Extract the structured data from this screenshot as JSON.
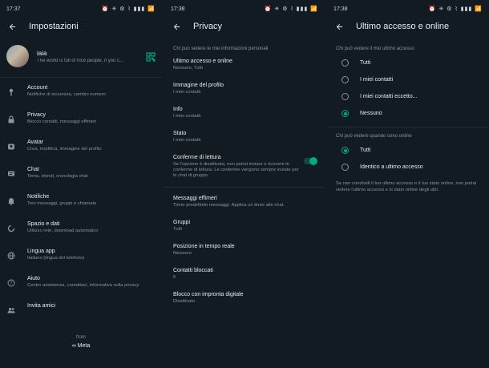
{
  "panel1": {
    "time": "17:37",
    "status_icons": "⏰ ✳ ⚙ ⌇ ▮▮▮ 📶",
    "title": "Impostazioni",
    "profile": {
      "name": "iaia",
      "about": "The world is full of nice people, if you c..."
    },
    "items": [
      {
        "icon": "key-icon",
        "label": "Account",
        "sub": "Notifiche di sicurezza, cambio numero"
      },
      {
        "icon": "lock-icon",
        "label": "Privacy",
        "sub": "Blocco contatti, messaggi effimeri"
      },
      {
        "icon": "avatar-icon",
        "label": "Avatar",
        "sub": "Crea, modifica, immagine del profilo"
      },
      {
        "icon": "chat-icon",
        "label": "Chat",
        "sub": "Tema, sfondi, cronologia chat"
      },
      {
        "icon": "bell-icon",
        "label": "Notifiche",
        "sub": "Toni messaggi, gruppi e chiamate"
      },
      {
        "icon": "data-usage-icon",
        "label": "Spazio e dati",
        "sub": "Utilizzo rete, download automatico"
      },
      {
        "icon": "globe-icon",
        "label": "Lingua app",
        "sub": "Italiano (lingua del telefono)"
      },
      {
        "icon": "help-icon",
        "label": "Aiuto",
        "sub": "Centro assistenza, contattaci, informativa sulla privacy"
      },
      {
        "icon": "people-icon",
        "label": "Invita amici",
        "sub": ""
      }
    ],
    "from_text": "from",
    "meta_text": "∞ Meta"
  },
  "panel2": {
    "time": "17:38",
    "status_icons": "⏰ ✳ ⚙ ⌇ ▮▮▮ 📶",
    "title": "Privacy",
    "section": "Chi può vedere le mie informazioni personali",
    "items": [
      {
        "label": "Ultimo accesso e online",
        "sub": "Nessuno, Tutti"
      },
      {
        "label": "Immagine del profilo",
        "sub": "I miei contatti"
      },
      {
        "label": "Info",
        "sub": "I miei contatti"
      },
      {
        "label": "Stato",
        "sub": "I miei contatti"
      }
    ],
    "read_receipts": {
      "label": "Conferme di lettura",
      "sub": "Se l'opzione è disattivata, non potrai inviare o ricevere le conferme di lettura. Le conferme vengono sempre inviate per le chat di gruppo.",
      "enabled": true
    },
    "items2": [
      {
        "label": "Messaggi effimeri",
        "sub": "Timer predefinito messaggi. Applica un timer alle chat."
      },
      {
        "label": "Gruppi",
        "sub": "Tutti"
      },
      {
        "label": "Posizione in tempo reale",
        "sub": "Nessuno"
      },
      {
        "label": "Contatti bloccati",
        "sub": "6"
      },
      {
        "label": "Blocco con impronta digitale",
        "sub": "Disattivato"
      }
    ]
  },
  "panel3": {
    "time": "17:38",
    "status_icons": "⏰ ✳ ⚙ ⌇ ▮▮▮ 📶",
    "title": "Ultimo accesso e online",
    "section1": "Chi può vedere il mio ultimo accesso",
    "options1": [
      {
        "label": "Tutti",
        "selected": false
      },
      {
        "label": "I miei contatti",
        "selected": false
      },
      {
        "label": "I miei contatti eccetto...",
        "selected": false
      },
      {
        "label": "Nessuno",
        "selected": true
      }
    ],
    "section2": "Chi può vedere quando sono online",
    "options2": [
      {
        "label": "Tutti",
        "selected": true
      },
      {
        "label": "Identico a ultimo accesso",
        "selected": false
      }
    ],
    "note": "Se non condividi il tuo ultimo accesso e il tuo stato online, non potrai vedere l'ultimo accesso e lo stato online degli altri."
  },
  "colors": {
    "background": "#111b21",
    "accent": "#00a884",
    "muted": "#8696a0",
    "text": "#e9edef"
  }
}
